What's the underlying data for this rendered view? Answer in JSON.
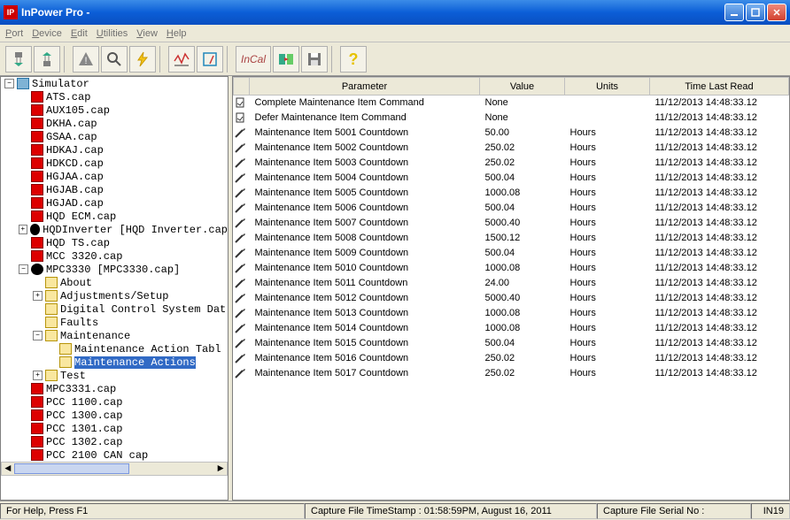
{
  "title": "InPower Pro -",
  "menu": {
    "port": "Port",
    "device": "Device",
    "edit": "Edit",
    "utilities": "Utilities",
    "view": "View",
    "help": "Help"
  },
  "tree": {
    "root": "Simulator",
    "items": [
      "ATS.cap",
      "AUX105.cap",
      "DKHA.cap",
      "GSAA.cap",
      "HDKAJ.cap",
      "HDKCD.cap",
      "HGJAA.cap",
      "HGJAB.cap",
      "HGJAD.cap",
      "HQD ECM.cap"
    ],
    "hqdinv": "HQDInverter [HQD Inverter.cap",
    "items2": [
      "HQD TS.cap",
      "MCC 3320.cap"
    ],
    "mpc3330": "MPC3330 [MPC3330.cap]",
    "mpc_children": [
      "About",
      "Adjustments/Setup",
      "Digital Control System Dat",
      "Faults",
      "Maintenance"
    ],
    "maint_children": [
      "Maintenance Action Tabl",
      "Maintenance Actions"
    ],
    "test": "Test",
    "items3": [
      "MPC3331.cap",
      "PCC 1100.cap",
      "PCC 1300.cap",
      "PCC 1301.cap",
      "PCC 1302.cap",
      "PCC 2100 CAN cap"
    ]
  },
  "grid": {
    "columns": {
      "param": "Parameter",
      "value": "Value",
      "units": "Units",
      "timeread": "Time Last Read"
    },
    "rows": [
      {
        "icon": "doc",
        "param": "Complete Maintenance Item Command",
        "value": "None",
        "units": "",
        "time": "11/12/2013 14:48:33.12"
      },
      {
        "icon": "doc",
        "param": "Defer Maintenance Item Command",
        "value": "None",
        "units": "",
        "time": "11/12/2013 14:48:33.12"
      },
      {
        "icon": "pen",
        "param": "Maintenance Item 5001 Countdown",
        "value": "50.00",
        "units": "Hours",
        "time": "11/12/2013 14:48:33.12"
      },
      {
        "icon": "pen",
        "param": "Maintenance Item 5002 Countdown",
        "value": "250.02",
        "units": "Hours",
        "time": "11/12/2013 14:48:33.12"
      },
      {
        "icon": "pen",
        "param": "Maintenance Item 5003 Countdown",
        "value": "250.02",
        "units": "Hours",
        "time": "11/12/2013 14:48:33.12"
      },
      {
        "icon": "pen",
        "param": "Maintenance Item 5004 Countdown",
        "value": "500.04",
        "units": "Hours",
        "time": "11/12/2013 14:48:33.12"
      },
      {
        "icon": "pen",
        "param": "Maintenance Item 5005 Countdown",
        "value": "1000.08",
        "units": "Hours",
        "time": "11/12/2013 14:48:33.12"
      },
      {
        "icon": "pen",
        "param": "Maintenance Item 5006 Countdown",
        "value": "500.04",
        "units": "Hours",
        "time": "11/12/2013 14:48:33.12"
      },
      {
        "icon": "pen",
        "param": "Maintenance Item 5007 Countdown",
        "value": "5000.40",
        "units": "Hours",
        "time": "11/12/2013 14:48:33.12"
      },
      {
        "icon": "pen",
        "param": "Maintenance Item 5008 Countdown",
        "value": "1500.12",
        "units": "Hours",
        "time": "11/12/2013 14:48:33.12"
      },
      {
        "icon": "pen",
        "param": "Maintenance Item 5009 Countdown",
        "value": "500.04",
        "units": "Hours",
        "time": "11/12/2013 14:48:33.12"
      },
      {
        "icon": "pen",
        "param": "Maintenance Item 5010 Countdown",
        "value": "1000.08",
        "units": "Hours",
        "time": "11/12/2013 14:48:33.12"
      },
      {
        "icon": "pen",
        "param": "Maintenance Item 5011 Countdown",
        "value": "24.00",
        "units": "Hours",
        "time": "11/12/2013 14:48:33.12"
      },
      {
        "icon": "pen",
        "param": "Maintenance Item 5012 Countdown",
        "value": "5000.40",
        "units": "Hours",
        "time": "11/12/2013 14:48:33.12"
      },
      {
        "icon": "pen",
        "param": "Maintenance Item 5013 Countdown",
        "value": "1000.08",
        "units": "Hours",
        "time": "11/12/2013 14:48:33.12"
      },
      {
        "icon": "pen",
        "param": "Maintenance Item 5014 Countdown",
        "value": "1000.08",
        "units": "Hours",
        "time": "11/12/2013 14:48:33.12"
      },
      {
        "icon": "pen",
        "param": "Maintenance Item 5015 Countdown",
        "value": "500.04",
        "units": "Hours",
        "time": "11/12/2013 14:48:33.12"
      },
      {
        "icon": "pen",
        "param": "Maintenance Item 5016 Countdown",
        "value": "250.02",
        "units": "Hours",
        "time": "11/12/2013 14:48:33.12"
      },
      {
        "icon": "pen",
        "param": "Maintenance Item 5017 Countdown",
        "value": "250.02",
        "units": "Hours",
        "time": "11/12/2013 14:48:33.12"
      }
    ]
  },
  "statusbar": {
    "help": "For Help, Press F1",
    "capture_ts": "Capture File TimeStamp : 01:58:59PM, August 16, 2011",
    "serial": "Capture File Serial No :",
    "in19": "IN19"
  }
}
